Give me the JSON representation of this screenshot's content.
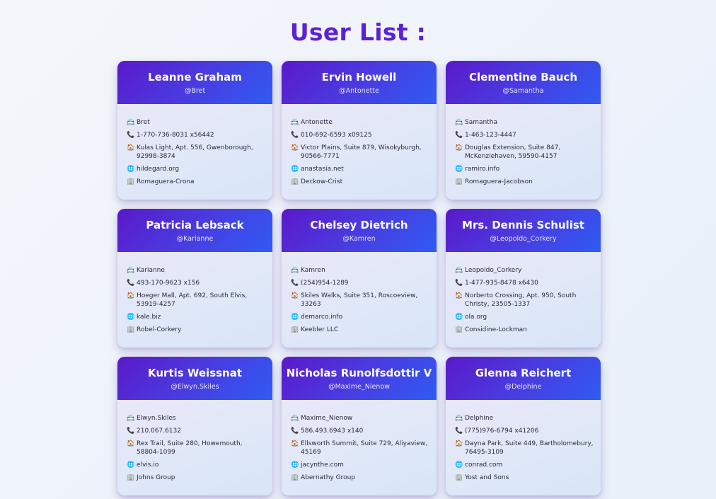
{
  "title": "User List :",
  "icons": {
    "username": "id-card-icon",
    "phone": "telephone-receiver-icon",
    "address": "house-icon",
    "website": "globe-icon",
    "company": "office-building-icon"
  },
  "users": [
    {
      "name": "Leanne Graham",
      "handle": "@Bret",
      "username": "Bret",
      "phone": "1-770-736-8031 x56442",
      "address": "Kulas Light, Apt. 556, Gwenborough, 92998-3874",
      "website": "hildegard.org",
      "company": "Romaguera-Crona"
    },
    {
      "name": "Ervin Howell",
      "handle": "@Antonette",
      "username": "Antonette",
      "phone": "010-692-6593 x09125",
      "address": "Victor Plains, Suite 879, Wisokyburgh, 90566-7771",
      "website": "anastasia.net",
      "company": "Deckow-Crist"
    },
    {
      "name": "Clementine Bauch",
      "handle": "@Samantha",
      "username": "Samantha",
      "phone": "1-463-123-4447",
      "address": "Douglas Extension, Suite 847, McKenziehaven, 59590-4157",
      "website": "ramiro.info",
      "company": "Romaguera-Jacobson"
    },
    {
      "name": "Patricia Lebsack",
      "handle": "@Karianne",
      "username": "Karianne",
      "phone": "493-170-9623 x156",
      "address": "Hoeger Mall, Apt. 692, South Elvis, 53919-4257",
      "website": "kale.biz",
      "company": "Robel-Corkery"
    },
    {
      "name": "Chelsey Dietrich",
      "handle": "@Kamren",
      "username": "Kamren",
      "phone": "(254)954-1289",
      "address": "Skiles Walks, Suite 351, Roscoeview, 33263",
      "website": "demarco.info",
      "company": "Keebler LLC"
    },
    {
      "name": "Mrs. Dennis Schulist",
      "handle": "@Leopoldo_Corkery",
      "username": "Leopoldo_Corkery",
      "phone": "1-477-935-8478 x6430",
      "address": "Norberto Crossing, Apt. 950, South Christy, 23505-1337",
      "website": "ola.org",
      "company": "Considine-Lockman"
    },
    {
      "name": "Kurtis Weissnat",
      "handle": "@Elwyn.Skiles",
      "username": "Elwyn.Skiles",
      "phone": "210.067.6132",
      "address": "Rex Trail, Suite 280, Howemouth, 58804-1099",
      "website": "elvis.io",
      "company": "Johns Group"
    },
    {
      "name": "Nicholas Runolfsdottir V",
      "handle": "@Maxime_Nienow",
      "username": "Maxime_Nienow",
      "phone": "586.493.6943 x140",
      "address": "Ellsworth Summit, Suite 729, Aliyaview, 45169",
      "website": "jacynthe.com",
      "company": "Abernathy Group"
    },
    {
      "name": "Glenna Reichert",
      "handle": "@Delphine",
      "username": "Delphine",
      "phone": "(775)976-6794 x41206",
      "address": "Dayna Park, Suite 449, Bartholomebury, 76495-3109",
      "website": "conrad.com",
      "company": "Yost and Sons"
    }
  ]
}
